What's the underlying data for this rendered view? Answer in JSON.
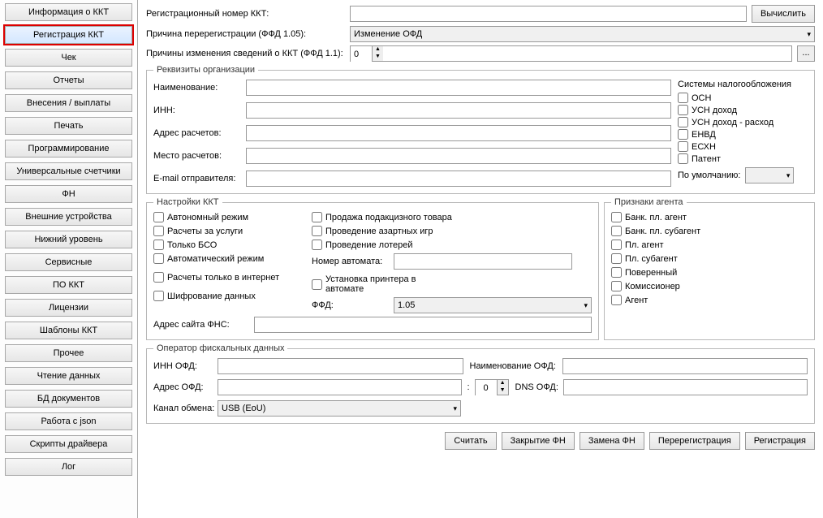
{
  "sidebar": {
    "items": [
      {
        "label": "Информация о ККТ"
      },
      {
        "label": "Регистрация ККТ"
      },
      {
        "label": "Чек"
      },
      {
        "label": "Отчеты"
      },
      {
        "label": "Внесения / выплаты"
      },
      {
        "label": "Печать"
      },
      {
        "label": "Программирование"
      },
      {
        "label": "Универсальные счетчики"
      },
      {
        "label": "ФН"
      },
      {
        "label": "Внешние устройства"
      },
      {
        "label": "Нижний уровень"
      },
      {
        "label": "Сервисные"
      },
      {
        "label": "ПО ККТ"
      },
      {
        "label": "Лицензии"
      },
      {
        "label": "Шаблоны ККТ"
      },
      {
        "label": "Прочее"
      },
      {
        "label": "Чтение данных"
      },
      {
        "label": "БД документов"
      },
      {
        "label": "Работа с json"
      },
      {
        "label": "Скрипты драйвера"
      },
      {
        "label": "Лог"
      }
    ],
    "active_index": 1
  },
  "top": {
    "reg_num_label": "Регистрационный номер ККТ:",
    "reg_num_value": "",
    "calc_btn": "Вычислить",
    "rereg_label": "Причина перерегистрации (ФФД 1.05):",
    "rereg_value": "Изменение ОФД",
    "reasons_label": "Причины изменения сведений о ККТ (ФФД 1.1):",
    "reasons_value": "0",
    "ellipsis": "..."
  },
  "org": {
    "legend": "Реквизиты организации",
    "name_label": "Наименование:",
    "inn_label": "ИНН:",
    "addr_label": "Адрес расчетов:",
    "place_label": "Место расчетов:",
    "email_label": "E-mail отправителя:",
    "name_value": "",
    "inn_value": "",
    "addr_value": "",
    "place_value": "",
    "email_value": "",
    "tax_title": "Системы налогообложения",
    "tax_options": [
      "ОСН",
      "УСН доход",
      "УСН доход - расход",
      "ЕНВД",
      "ЕСХН",
      "Патент"
    ],
    "default_label": "По умолчанию:",
    "default_value": ""
  },
  "kkt": {
    "legend": "Настройки ККТ",
    "col1": [
      "Автономный режим",
      "Расчеты за услуги",
      "Только БСО",
      "Автоматический режим"
    ],
    "internet_only": "Расчеты только в интернет",
    "encrypt": "Шифрование данных",
    "col2": [
      "Продажа подакцизного товара",
      "Проведение азартных игр",
      "Проведение лотерей"
    ],
    "machine_label": "Номер автомата:",
    "machine_value": "",
    "printer_install": "Установка принтера в автомате",
    "ffd_label": "ФФД:",
    "ffd_value": "1.05",
    "fns_label": "Адрес сайта ФНС:",
    "fns_value": ""
  },
  "agent": {
    "legend": "Признаки агента",
    "options": [
      "Банк. пл. агент",
      "Банк. пл. субагент",
      "Пл. агент",
      "Пл. субагент",
      "Поверенный",
      "Комиссионер",
      "Агент"
    ]
  },
  "ofd": {
    "legend": "Оператор фискальных данных",
    "inn_label": "ИНН ОФД:",
    "inn_value": "",
    "name_label": "Наименование ОФД:",
    "name_value": "",
    "addr_label": "Адрес ОФД:",
    "addr_value": "",
    "port_value": "0",
    "dns_label": "DNS ОФД:",
    "dns_value": "",
    "channel_label": "Канал обмена:",
    "channel_value": "USB (EoU)"
  },
  "bottom": {
    "read": "Считать",
    "close_fn": "Закрытие ФН",
    "replace_fn": "Замена ФН",
    "rereg": "Перерегистрация",
    "reg": "Регистрация"
  }
}
